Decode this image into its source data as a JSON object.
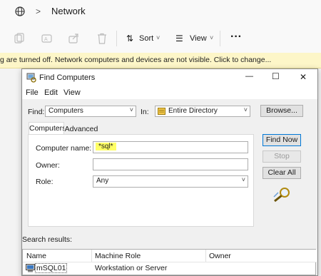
{
  "explorer": {
    "breadcrumb_root_icon": "globe-icon",
    "breadcrumb_separator": ">",
    "location": "Network",
    "toolbar": {
      "sort_label": "Sort",
      "view_label": "View",
      "more_label": "···"
    },
    "banner_text": "g are turned off. Network computers and devices are not visible. Click to change..."
  },
  "dialog": {
    "title": "Find Computers",
    "controls": {
      "minimize": "—",
      "maximize": "☐",
      "close": "✕"
    },
    "menu": [
      "File",
      "Edit",
      "View"
    ],
    "find_label": "Find:",
    "find_value": "Computers",
    "in_label": "In:",
    "in_value": "Entire Directory",
    "browse_label": "Browse...",
    "tabs": [
      "Computers",
      "Advanced"
    ],
    "computer_name_label": "Computer name:",
    "computer_name_value": "*sql*",
    "owner_label": "Owner:",
    "owner_value": "",
    "role_label": "Role:",
    "role_value": "Any",
    "buttons": {
      "find_now": "Find Now",
      "stop": "Stop",
      "clear_all": "Clear All"
    },
    "search_results_label": "Search results:",
    "columns": [
      "Name",
      "Machine Role",
      "Owner"
    ],
    "rows": [
      {
        "name": "mSQL01",
        "role": "Workstation or Server",
        "owner": ""
      }
    ]
  },
  "colors": {
    "banner": "#fdf6c8",
    "highlight": "#ffff66",
    "accent": "#0078d7"
  }
}
